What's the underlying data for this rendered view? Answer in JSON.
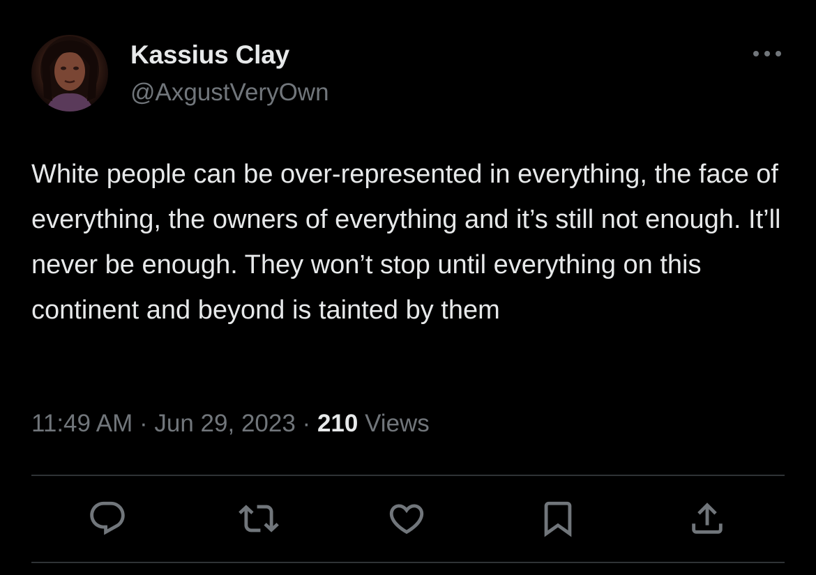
{
  "tweet": {
    "author": {
      "display_name": "Kassius Clay",
      "handle": "@AxgustVeryOwn",
      "avatar_icon": "profile-photo"
    },
    "more_icon": "more-dots-icon",
    "text": "White people can be over-represented in everything, the face of everything, the owners of everything and it’s still not enough. It’ll never be enough. They won’t stop until everything on this continent and beyond is tainted by them",
    "time": "11:49 AM",
    "separator": "·",
    "date": "Jun 29, 2023",
    "views_count": "210",
    "views_label": "Views"
  },
  "actions": [
    {
      "name": "reply",
      "icon": "reply-icon"
    },
    {
      "name": "retweet",
      "icon": "retweet-icon"
    },
    {
      "name": "like",
      "icon": "heart-icon"
    },
    {
      "name": "bookmark",
      "icon": "bookmark-icon"
    },
    {
      "name": "share",
      "icon": "share-icon"
    }
  ],
  "colors": {
    "background": "#000000",
    "primary_text": "#e7e9ea",
    "secondary_text": "#71767b",
    "divider": "#2f3336"
  }
}
